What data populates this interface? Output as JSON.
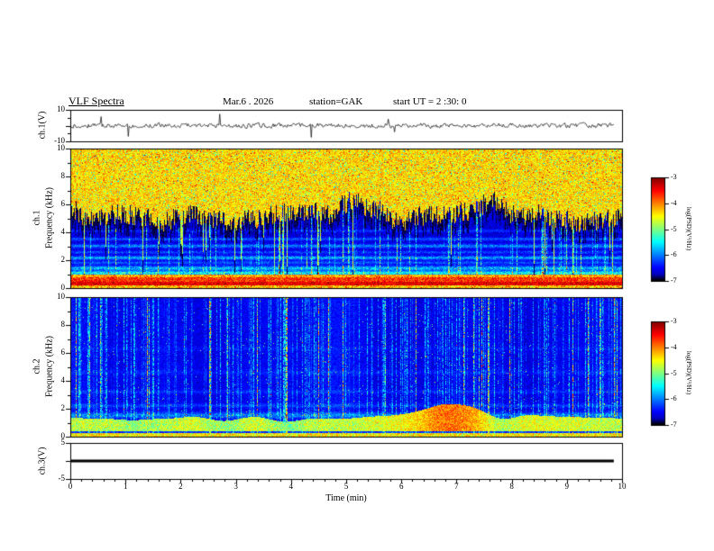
{
  "header": {
    "title": "VLF Spectra",
    "date": "Mar.6 . 2026",
    "station": "station=GAK",
    "start_ut": "start UT =  2 :30: 0"
  },
  "xaxis": {
    "label": "Time (min)",
    "lim": [
      0,
      10
    ],
    "ticks": [
      "0",
      "1",
      "2",
      "3",
      "4",
      "5",
      "6",
      "7",
      "8",
      "9",
      "10"
    ]
  },
  "panels": {
    "ch1_wave": {
      "label": "ch.1(V)",
      "ylim": [
        -10,
        10
      ],
      "yticks": [
        "10",
        "-10"
      ]
    },
    "ch1_spec": {
      "label_channel": "ch.1",
      "label_axis": "Frequency (kHz)",
      "ylim": [
        0,
        10
      ],
      "yticks": [
        "10",
        "8",
        "6",
        "4",
        "2",
        "0"
      ]
    },
    "ch2_spec": {
      "label_channel": "ch.2",
      "label_axis": "Frequency (kHz)",
      "ylim": [
        0,
        10
      ],
      "yticks": [
        "10",
        "8",
        "6",
        "4",
        "2",
        "0"
      ]
    },
    "ch3_wave": {
      "label": "ch.3(V)",
      "ylim": [
        -5,
        5
      ],
      "yticks": [
        "5",
        "-5"
      ]
    }
  },
  "colorbars": [
    {
      "label": "log(PSD)(V²/Hz)",
      "range": [
        -7,
        -3
      ],
      "ticks": [
        "-3",
        "-4",
        "-5",
        "-6",
        "-7"
      ]
    },
    {
      "label": "log(PSD)(V²/Hz)",
      "range": [
        -7,
        -3
      ],
      "ticks": [
        "-3",
        "-4",
        "-5",
        "-6",
        "-7"
      ]
    }
  ],
  "chart_data": [
    {
      "type": "line",
      "name": "ch.1(V) time series",
      "xlim": [
        0,
        10
      ],
      "ylim": [
        -10,
        10
      ],
      "description": "Broadband noise waveform centred on 0 V, typical amplitude about ±2 V with sporadic impulsive spikes reaching roughly ±8 V, extending from 0 to about 9.8 min."
    },
    {
      "type": "heatmap",
      "name": "ch.1 spectrogram",
      "xlim": [
        0,
        10
      ],
      "ylim": [
        0,
        10
      ],
      "ylabel": "Frequency (kHz)",
      "colorbar_label": "log(PSD)(V²/Hz)",
      "clim": [
        -7,
        -3
      ],
      "colormap": "jet",
      "features": [
        "strong broadband power (green/yellow, about -4.5) above a jagged lower cutoff varying between roughly 4.5 and 6.5 kHz",
        "scattered red specks (about -3) within the upper band and along the top edge",
        "dark background (about -6.8) between roughly 1 and 5 kHz with faint blue horizontal bands near 1.1, 1.4, 2.1, 3.0 and 3.5 kHz",
        "dense thin vertical impulsive streaks crossing the dark region",
        "intense red/orange band (about -3.2) below roughly 0.9 kHz with yellow-green fringes"
      ]
    },
    {
      "type": "heatmap",
      "name": "ch.2 spectrogram",
      "xlim": [
        0,
        10
      ],
      "ylim": [
        0,
        10
      ],
      "ylabel": "Frequency (kHz)",
      "colorbar_label": "log(PSD)(V²/Hz)",
      "clim": [
        -7,
        -3
      ],
      "colormap": "jet",
      "features": [
        "mostly dark background (about -6.8) with many blue/cyan vertical impulsive streaks at all frequencies",
        "faint blue horizontal band near 1.5 kHz",
        "green band (about -4.8) between roughly 0.4 and 1.1 kHz that brightens and widens to about 2 kHz near 7 min",
        "thin green/yellow line along the bottom edge below about 0.2 kHz"
      ]
    },
    {
      "type": "line",
      "name": "ch.3(V) time series",
      "xlim": [
        0,
        10
      ],
      "ylim": [
        -5,
        5
      ],
      "description": "Constant flat line at 0 V from 0 to about 9.8 min."
    }
  ]
}
